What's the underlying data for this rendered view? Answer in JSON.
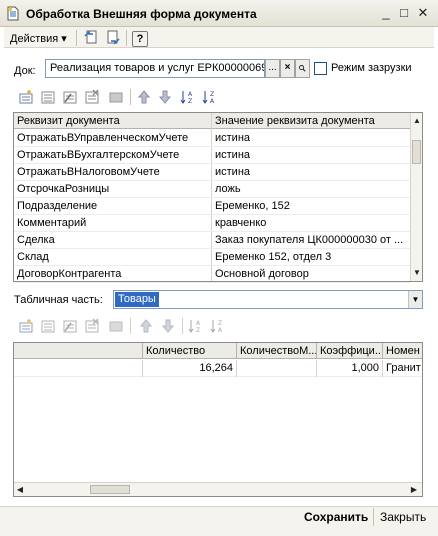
{
  "window": {
    "title": "Обработка  Внешняя форма документа",
    "controls": [
      "_",
      "□",
      "✕"
    ]
  },
  "command_bar": {
    "actions_label": "Действия",
    "actions_arrow": "▾",
    "help_label": "?"
  },
  "doc_row": {
    "label": "Док:",
    "value": "Реализация товаров и услуг ЕРК00000069",
    "select_btn": "...",
    "clear_btn": "×",
    "search_btn": "🔍",
    "checkbox_label": "Режим зазрузки"
  },
  "requisites": {
    "headers": [
      "Реквизит документа",
      "Значение реквизита документа"
    ],
    "rows": [
      {
        "name": "ОтражатьВУправленческомУчете",
        "value": "истина"
      },
      {
        "name": "ОтражатьВБухгалтерскомУчете",
        "value": "истина"
      },
      {
        "name": "ОтражатьВНалоговомУчете",
        "value": "истина"
      },
      {
        "name": "ОтсрочкаРозницы",
        "value": "ложь"
      },
      {
        "name": "Подразделение",
        "value": "Еременко, 152"
      },
      {
        "name": "Комментарий",
        "value": "кравченко"
      },
      {
        "name": "Сделка",
        "value": "Заказ покупателя ЦК000000030 от ..."
      },
      {
        "name": "Склад",
        "value": "Еременко 152, отдел 3"
      },
      {
        "name": "ДоговорКонтрагента",
        "value": "Основной договор"
      }
    ]
  },
  "tabular": {
    "label": "Табличная часть:",
    "selected": "Товары",
    "headers": [
      "",
      "Количество",
      "КоличествоМ...",
      "Коэффици...",
      "Номен"
    ],
    "rows": [
      [
        "",
        "16,264",
        "",
        "1,000",
        "Гранит"
      ]
    ]
  },
  "footer": {
    "save_label": "Сохранить",
    "close_label": "Закрыть"
  },
  "colors": {
    "selection": "#316ac5",
    "border": "#7f9db9",
    "header_bg": "#ecebe5"
  }
}
